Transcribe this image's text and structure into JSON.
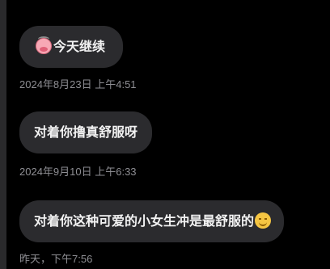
{
  "messages": [
    {
      "text": "今天继续",
      "leading_icon": "angry-cow-face-icon",
      "trailing_icon": null,
      "timestamp": "2024年8月23日 上午4:51"
    },
    {
      "text": "对着你撸真舒服呀",
      "leading_icon": null,
      "trailing_icon": null,
      "timestamp": "2024年9月10日 上午6:33"
    },
    {
      "text": "对着你这种可爱的小女生冲是最舒服的",
      "leading_icon": null,
      "trailing_icon": "smiling-face-icon",
      "timestamp": "昨天，下午7:56"
    }
  ],
  "colors": {
    "background": "#000000",
    "bubble": "#2b2b2e",
    "text": "#f2f2f2",
    "timestamp": "#8e8e93"
  }
}
